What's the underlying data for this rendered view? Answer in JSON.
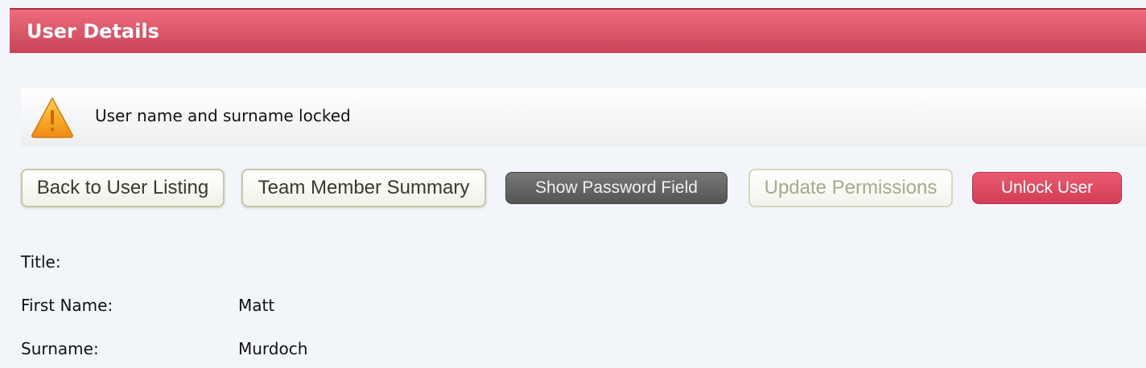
{
  "header": {
    "title": "User Details"
  },
  "notice": {
    "icon": "warning-icon",
    "text": "User name and surname locked"
  },
  "actions": {
    "back": "Back to User Listing",
    "summary": "Team Member Summary",
    "show_password": "Show Password Field",
    "update_permissions": "Update Permissions",
    "unlock": "Unlock User"
  },
  "fields": {
    "title": {
      "label": "Title:",
      "value": ""
    },
    "first_name": {
      "label": "First Name:",
      "value": "Matt"
    },
    "surname": {
      "label": "Surname:",
      "value": "Murdoch"
    }
  },
  "colors": {
    "header": "#d84c61",
    "background": "#f2f6fa",
    "accent_red": "#d23e55",
    "warning": "#f39a1e"
  }
}
